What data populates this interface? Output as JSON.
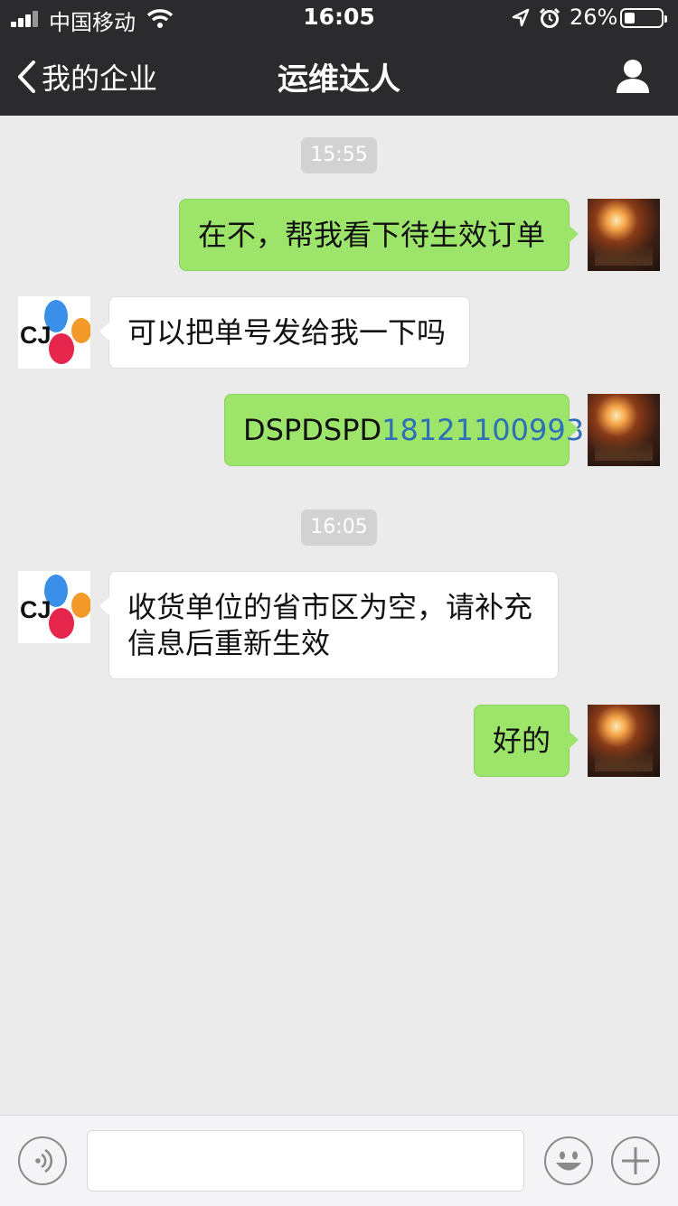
{
  "status_bar": {
    "carrier": "中国移动",
    "time": "16:05",
    "battery_percent": "26%",
    "battery_level": 0.26,
    "icons": [
      "signal-icon",
      "wifi-icon",
      "location-icon",
      "alarm-icon",
      "battery-icon"
    ]
  },
  "nav": {
    "back_label": "我的企业",
    "title": "运维达人",
    "right_icon": "profile-icon"
  },
  "chat": {
    "timestamps": [
      "15:55",
      "16:05"
    ],
    "messages": [
      {
        "side": "out",
        "text": "在不，帮我看下待生效订单"
      },
      {
        "side": "in",
        "sender_logo": "CJ",
        "text": "可以把单号发给我一下吗"
      },
      {
        "side": "out",
        "text_prefix": "DSPDSPD",
        "text_link": "18121100993"
      },
      {
        "side": "in",
        "sender_logo": "CJ",
        "text_line1": "收货单位的省市区为空，请补充",
        "text_line2": "信息后重新生效"
      },
      {
        "side": "out",
        "text": "好的"
      }
    ]
  },
  "input_bar": {
    "value": "",
    "icons": [
      "voice-icon",
      "emoji-icon",
      "plus-icon"
    ]
  },
  "colors": {
    "nav_bg": "#2b2b2d",
    "chat_bg": "#ebebeb",
    "outgoing_bubble": "#9de46b",
    "incoming_bubble": "#ffffff",
    "link": "#2f6fb8"
  }
}
